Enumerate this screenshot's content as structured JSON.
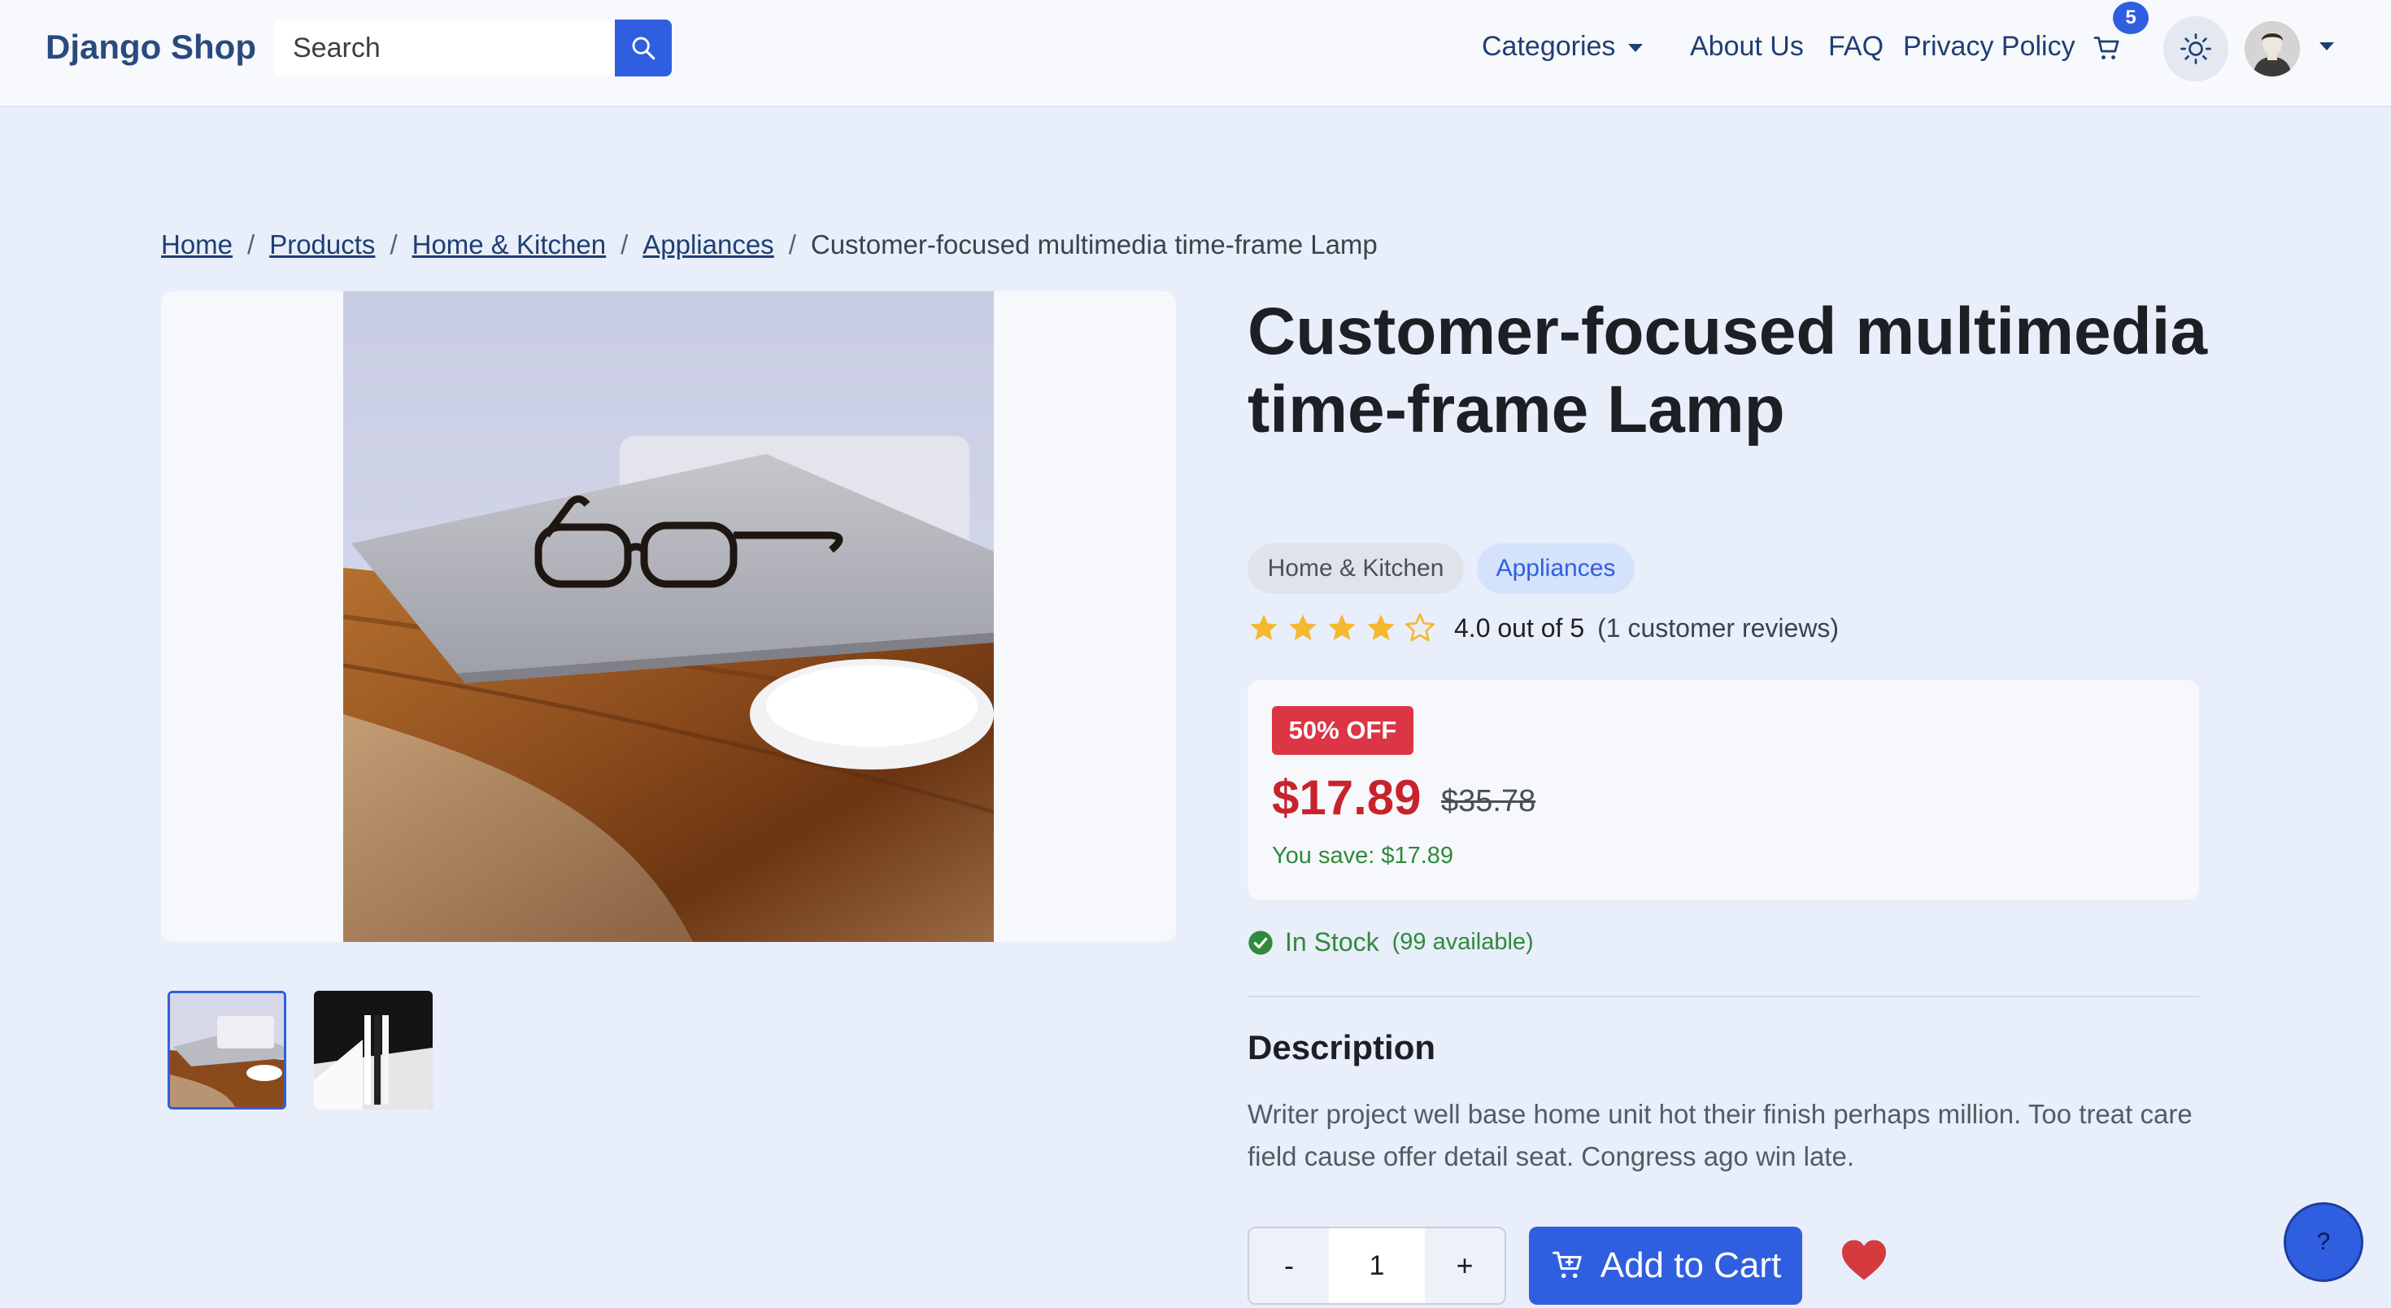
{
  "navbar": {
    "brand": "Django Shop",
    "search_placeholder": "Search",
    "categories_label": "Categories",
    "links": [
      "About Us",
      "FAQ",
      "Privacy Policy"
    ],
    "cart_count": "5",
    "icons": [
      "search-icon",
      "cart-icon",
      "sun-icon",
      "avatar",
      "chevron-down-icon"
    ]
  },
  "breadcrumb": {
    "items": [
      "Home",
      "Products",
      "Home & Kitchen",
      "Appliances"
    ],
    "current": "Customer-focused multimedia time-frame Lamp",
    "separator": "/"
  },
  "product": {
    "title": "Customer-focused multimedia time-frame Lamp",
    "tags": [
      "Home & Kitchen",
      "Appliances"
    ],
    "rating": {
      "value": 4,
      "max": 5,
      "text": "4.0 out of 5",
      "count_text": "(1 customer reviews)"
    },
    "pricing": {
      "discount_badge": "50% OFF",
      "price": "$17.89",
      "original_price": "$35.78",
      "savings": "You save: $17.89"
    },
    "stock": {
      "label": "In Stock",
      "available": "(99 available)"
    },
    "description": {
      "heading": "Description",
      "text": "Writer project well base home unit hot their finish perhaps million. Too treat care field cause offer detail seat. Congress ago win late."
    },
    "gallery": {
      "thumbnails": [
        "laptop-glasses-thumb",
        "abstract-dark-thumb"
      ],
      "active_index": 0
    }
  },
  "actions": {
    "qty_minus": "-",
    "qty_value": "1",
    "qty_plus": "+",
    "add_to_cart": "Add to Cart",
    "help": "?"
  },
  "colors": {
    "accent": "#2f5fe0",
    "sale": "#dc3545",
    "price": "#c8232c",
    "success": "#2f8a3b",
    "star": "#f5b82e",
    "page_bg": "#e8eefa"
  }
}
